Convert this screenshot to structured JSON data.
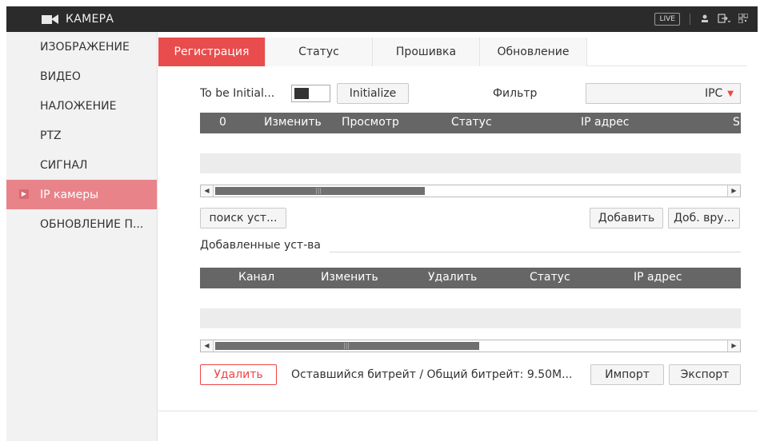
{
  "header": {
    "title": "КАМЕРА",
    "live_label": "LIVE",
    "icons": [
      "camera-icon",
      "user-icon",
      "logout-icon",
      "qr-icon"
    ]
  },
  "sidebar": {
    "items": [
      {
        "label": "ИЗОБРАЖЕНИЕ"
      },
      {
        "label": "ВИДЕО"
      },
      {
        "label": "НАЛОЖЕНИЕ"
      },
      {
        "label": "PTZ"
      },
      {
        "label": "СИГНАЛ"
      },
      {
        "label": "IP камеры",
        "active": true
      },
      {
        "label": "ОБНОВЛЕНИЕ П..."
      }
    ]
  },
  "tabs": [
    {
      "label": "Регистрация",
      "active": true
    },
    {
      "label": "Статус"
    },
    {
      "label": "Прошивка"
    },
    {
      "label": "Обновление"
    }
  ],
  "registration": {
    "to_be_initialized_label": "To be Initial...",
    "initialize_button": "Initialize",
    "filter_label": "Фильтр",
    "filter_value": "IPC",
    "search_table": {
      "columns": [
        "0",
        "Изменить",
        "Просмотр",
        "Статус",
        "IP адрес",
        "S"
      ],
      "rows": []
    },
    "search_device_button": "поиск уст...",
    "add_button": "Добавить",
    "manual_add_button": "Доб. вру...",
    "added_devices_title": "Добавленные уст-ва",
    "added_table": {
      "columns": [
        "Канал",
        "Изменить",
        "Удалить",
        "Статус",
        "IP адрес"
      ],
      "rows": []
    },
    "delete_button": "Удалить",
    "bitrate_text": "Оставшийся битрейт / Общий битрейт: 9.50M...",
    "import_button": "Импорт",
    "export_button": "Экспорт"
  },
  "colors": {
    "accent": "#e94c4c",
    "sidebar_active": "#e8838a",
    "topbar": "#2b2b2b",
    "table_header": "#666666"
  }
}
